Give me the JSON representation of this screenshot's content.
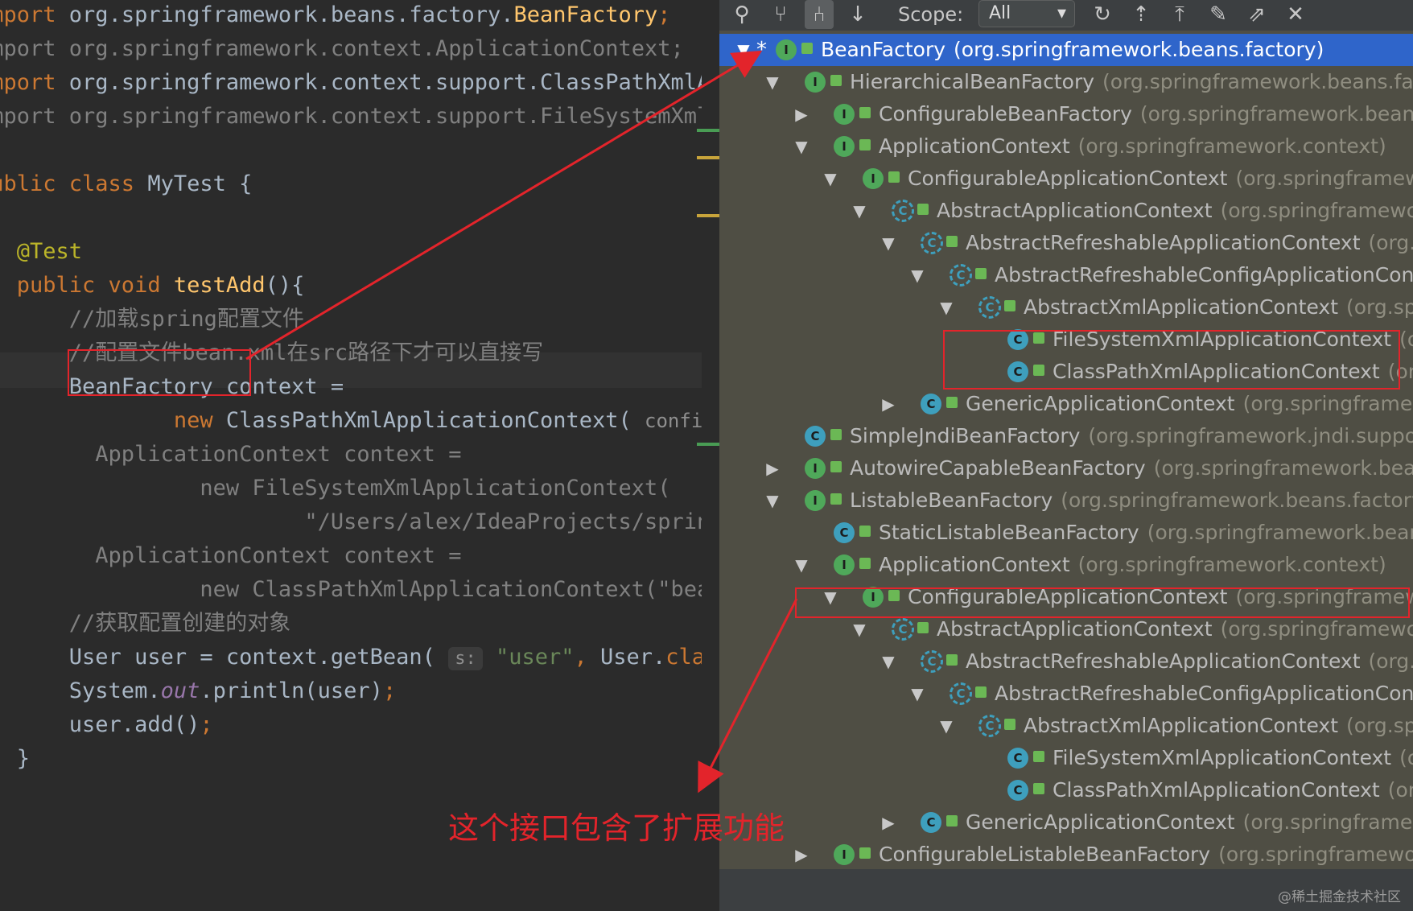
{
  "editor": {
    "lines": [
      {
        "segments": [
          {
            "text": "import ",
            "cls": "kw"
          },
          {
            "text": "org.springframework.beans.factory.",
            "cls": ""
          },
          {
            "text": "BeanFactory",
            "cls": "fn"
          },
          {
            "text": ";",
            "cls": "kw"
          }
        ]
      },
      {
        "segments": [
          {
            "text": "import org.springframework.context.ApplicationContext;",
            "cls": "cm"
          }
        ]
      },
      {
        "segments": [
          {
            "text": "import ",
            "cls": "kw"
          },
          {
            "text": "org.springframework.context.support.ClassPathXmlApplicationContext;",
            "cls": ""
          }
        ]
      },
      {
        "segments": [
          {
            "text": "import org.springframework.context.support.FileSystemXmlApplicationContext;",
            "cls": "cm"
          }
        ]
      },
      {
        "segments": []
      },
      {
        "segments": [
          {
            "text": "public class ",
            "cls": "kw"
          },
          {
            "text": "MyTest {",
            "cls": ""
          }
        ]
      },
      {
        "segments": []
      },
      {
        "segments": [
          {
            "text": "   @Test",
            "cls": "ann"
          }
        ]
      },
      {
        "segments": [
          {
            "text": "   public void ",
            "cls": "kw"
          },
          {
            "text": "testAdd",
            "cls": "fn"
          },
          {
            "text": "(){",
            "cls": ""
          }
        ]
      },
      {
        "segments": [
          {
            "text": "       //加载spring配置文件",
            "cls": "cm"
          }
        ]
      },
      {
        "segments": [
          {
            "text": "       //配置文件bean.xml在src路径下才可以直接写",
            "cls": "cm"
          }
        ]
      },
      {
        "segments": [
          {
            "text": "       BeanFactory context =",
            "cls": ""
          }
        ]
      },
      {
        "segments": [
          {
            "text": "               new ",
            "cls": "kw"
          },
          {
            "text": "ClassPathXmlApplicationContext( ",
            "cls": ""
          },
          {
            "text": "configLocation:",
            "cls": "inlay"
          }
        ]
      },
      {
        "segments": [
          {
            "text": "/        ApplicationContext context =",
            "cls": "cm"
          }
        ]
      },
      {
        "segments": [
          {
            "text": "/                new FileSystemXmlApplicationContext(",
            "cls": "cm"
          }
        ]
      },
      {
        "segments": [
          {
            "text": "/                        \"/Users/alex/IdeaProjects/spring",
            "cls": "cm"
          }
        ]
      },
      {
        "segments": [
          {
            "text": "/        ApplicationContext context =",
            "cls": "cm"
          }
        ]
      },
      {
        "segments": [
          {
            "text": "/                new ClassPathXmlApplicationContext(\"bean.xml\");",
            "cls": "cm"
          }
        ]
      },
      {
        "segments": [
          {
            "text": "       //获取配置创建的对象",
            "cls": "cm"
          }
        ]
      },
      {
        "segments": [
          {
            "text": "       User user = context.getBean( ",
            "cls": ""
          },
          {
            "text": "s:",
            "cls": "hint"
          },
          {
            "text": " \"user\"",
            "cls": "str"
          },
          {
            "text": ", ",
            "cls": "kw"
          },
          {
            "text": "User.",
            "cls": ""
          },
          {
            "text": "class",
            "cls": "kw"
          }
        ]
      },
      {
        "segments": [
          {
            "text": "       System.",
            "cls": ""
          },
          {
            "text": "out",
            "cls": "st"
          },
          {
            "text": ".println(user)",
            "cls": ""
          },
          {
            "text": ";",
            "cls": "kw"
          }
        ]
      },
      {
        "segments": [
          {
            "text": "       user.add()",
            "cls": ""
          },
          {
            "text": ";",
            "cls": "kw"
          }
        ]
      },
      {
        "segments": [
          {
            "text": "   }",
            "cls": ""
          }
        ]
      }
    ]
  },
  "toolbar": {
    "scope_label": "Scope:",
    "scope_value": "All",
    "icons": [
      "class-hierarchy-icon",
      "supertypes-icon",
      "subtypes-icon",
      "sort-alphabetically-icon",
      "refresh-icon",
      "export-icon",
      "collapse-all-icon",
      "pin-icon",
      "open-in-window-icon",
      "close-icon"
    ]
  },
  "tree": [
    {
      "depth": 0,
      "arrow": "expanded",
      "kind": "interface",
      "name": "BeanFactory",
      "pkg": "(org.springframework.beans.factory)",
      "selected": true,
      "star": true
    },
    {
      "depth": 1,
      "arrow": "expanded",
      "kind": "interface",
      "name": "HierarchicalBeanFactory",
      "pkg": "(org.springframework.beans.factory)"
    },
    {
      "depth": 2,
      "arrow": "collapsed",
      "kind": "interface",
      "name": "ConfigurableBeanFactory",
      "pkg": "(org.springframework.beans.factory.config)"
    },
    {
      "depth": 2,
      "arrow": "expanded",
      "kind": "interface",
      "name": "ApplicationContext",
      "pkg": "(org.springframework.context)"
    },
    {
      "depth": 3,
      "arrow": "expanded",
      "kind": "interface",
      "name": "ConfigurableApplicationContext",
      "pkg": "(org.springframework.context)"
    },
    {
      "depth": 4,
      "arrow": "expanded",
      "kind": "abstract",
      "name": "AbstractApplicationContext",
      "pkg": "(org.springframework.context.support)"
    },
    {
      "depth": 5,
      "arrow": "expanded",
      "kind": "abstract",
      "name": "AbstractRefreshableApplicationContext",
      "pkg": "(org.springframework.context.support)"
    },
    {
      "depth": 6,
      "arrow": "expanded",
      "kind": "abstract",
      "name": "AbstractRefreshableConfigApplicationContext",
      "pkg": "(org.springframework.context.support)"
    },
    {
      "depth": 7,
      "arrow": "expanded",
      "kind": "abstract",
      "name": "AbstractXmlApplicationContext",
      "pkg": "(org.springframework.context.support)"
    },
    {
      "depth": 8,
      "arrow": "none",
      "kind": "class",
      "name": "FileSystemXmlApplicationContext",
      "pkg": "(org.springframework.context.support)"
    },
    {
      "depth": 8,
      "arrow": "none",
      "kind": "class",
      "name": "ClassPathXmlApplicationContext",
      "pkg": "(org.springframework.context.support)"
    },
    {
      "depth": 5,
      "arrow": "collapsed",
      "kind": "class",
      "name": "GenericApplicationContext",
      "pkg": "(org.springframework.context.support)"
    },
    {
      "depth": 1,
      "arrow": "none",
      "kind": "class",
      "name": "SimpleJndiBeanFactory",
      "pkg": "(org.springframework.jndi.support)"
    },
    {
      "depth": 1,
      "arrow": "collapsed",
      "kind": "interface",
      "name": "AutowireCapableBeanFactory",
      "pkg": "(org.springframework.beans.factory.config)"
    },
    {
      "depth": 1,
      "arrow": "expanded",
      "kind": "interface",
      "name": "ListableBeanFactory",
      "pkg": "(org.springframework.beans.factory)"
    },
    {
      "depth": 2,
      "arrow": "none",
      "kind": "class",
      "name": "StaticListableBeanFactory",
      "pkg": "(org.springframework.beans.factory.support)"
    },
    {
      "depth": 2,
      "arrow": "expanded",
      "kind": "interface",
      "name": "ApplicationContext",
      "pkg": "(org.springframework.context)"
    },
    {
      "depth": 3,
      "arrow": "expanded",
      "kind": "interface",
      "name": "ConfigurableApplicationContext",
      "pkg": "(org.springframework.context)"
    },
    {
      "depth": 4,
      "arrow": "expanded",
      "kind": "abstract",
      "name": "AbstractApplicationContext",
      "pkg": "(org.springframework.context.support)"
    },
    {
      "depth": 5,
      "arrow": "expanded",
      "kind": "abstract",
      "name": "AbstractRefreshableApplicationContext",
      "pkg": "(org.springframework.context.support)"
    },
    {
      "depth": 6,
      "arrow": "expanded",
      "kind": "abstract",
      "name": "AbstractRefreshableConfigApplicationContext",
      "pkg": "(org.springframework.context.support)"
    },
    {
      "depth": 7,
      "arrow": "expanded",
      "kind": "abstract",
      "name": "AbstractXmlApplicationContext",
      "pkg": "(org.springframework.context.support)"
    },
    {
      "depth": 8,
      "arrow": "none",
      "kind": "class",
      "name": "FileSystemXmlApplicationContext",
      "pkg": "(org.springframework.context.support)"
    },
    {
      "depth": 8,
      "arrow": "none",
      "kind": "class",
      "name": "ClassPathXmlApplicationContext",
      "pkg": "(org.springframework.context.support)"
    },
    {
      "depth": 5,
      "arrow": "collapsed",
      "kind": "class",
      "name": "GenericApplicationContext",
      "pkg": "(org.springframework.context.support)"
    },
    {
      "depth": 2,
      "arrow": "collapsed",
      "kind": "interface",
      "name": "ConfigurableListableBeanFactory",
      "pkg": "(org.springframework.beans.factory.config)"
    }
  ],
  "annotation": {
    "text": "这个接口包含了扩展功能",
    "color": "#e3242b"
  },
  "watermark": "@稀土掘金技术社区",
  "colors": {
    "editor_bg": "#2b2b2b",
    "panel_bg": "#4f4e44",
    "selection": "#2f65ca",
    "interface_icon": "#4fa85a",
    "class_icon": "#3e9fbd"
  }
}
